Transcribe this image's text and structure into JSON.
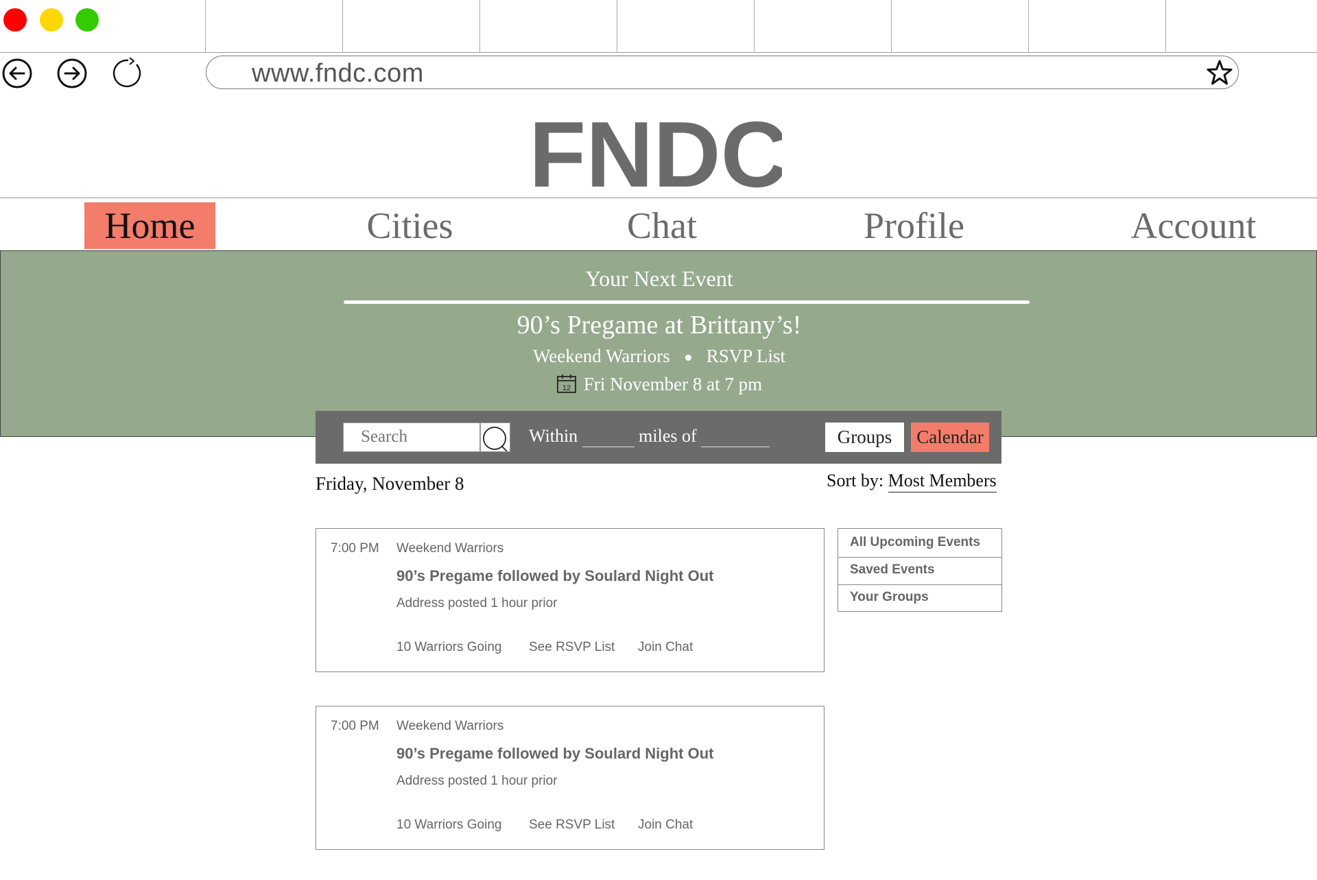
{
  "browser": {
    "url": "www.fndc.com",
    "traffic_lights": [
      "#ff0000",
      "#ffd700",
      "#33cc00"
    ]
  },
  "logo": {
    "text": "FNDC"
  },
  "nav": {
    "items": [
      {
        "label": "Home",
        "active": true
      },
      {
        "label": "Cities",
        "active": false
      },
      {
        "label": "Chat",
        "active": false
      },
      {
        "label": "Profile",
        "active": false
      },
      {
        "label": "Account",
        "active": false
      }
    ]
  },
  "next_event": {
    "heading": "Your Next Event",
    "name": "90’s Pregame at Brittany’s!",
    "group": "Weekend Warriors",
    "rsvp": "RSVP List",
    "calendar_day": "12",
    "date": "Fri November 8 at 7 pm"
  },
  "search": {
    "placeholder": "Search",
    "within": "Within",
    "miles_of": "miles of",
    "groups_label": "Groups",
    "calendar_label": "Calendar"
  },
  "list": {
    "date_heading": "Friday, November 8",
    "sort_label": "Sort by:",
    "sort_value": "Most Members"
  },
  "events": [
    {
      "time": "7:00 PM",
      "group": "Weekend Warriors",
      "title": "90’s Pregame followed by Soulard Night Out",
      "address": "Address posted 1 hour prior",
      "going": "10 Warriors Going",
      "rsvp": "See RSVP List",
      "chat": "Join Chat"
    },
    {
      "time": "7:00 PM",
      "group": "Weekend Warriors",
      "title": "90’s Pregame followed by Soulard Night Out",
      "address": "Address posted 1 hour prior",
      "going": "10 Warriors Going",
      "rsvp": "See RSVP List",
      "chat": "Join Chat"
    }
  ],
  "side_menu": {
    "items": [
      "All Upcoming Events",
      "Saved Events",
      "Your Groups"
    ]
  },
  "colors": {
    "accent": "#f47c6a",
    "banner": "#95a98c",
    "toolbar": "#6b6b6b",
    "logo": "#6b6b6b"
  }
}
